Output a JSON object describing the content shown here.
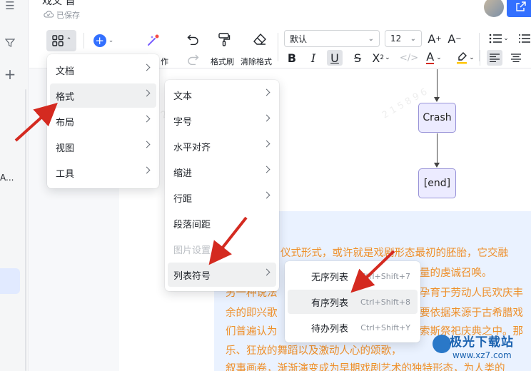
{
  "titlebar": {
    "doc_title": "戏文 首",
    "saved_text": "已保存"
  },
  "left_rail": {
    "partial_text": "A..."
  },
  "toolbar": {
    "font_family": "默认",
    "font_size": "12",
    "ai_label_fragment": "作",
    "format_painter_label": "格式刷",
    "clear_format_label": "清除格式",
    "superscript_mark": "2"
  },
  "main_menu": {
    "items": [
      {
        "label": "文档"
      },
      {
        "label": "格式"
      },
      {
        "label": "布局"
      },
      {
        "label": "视图"
      },
      {
        "label": "工具"
      }
    ]
  },
  "format_menu": {
    "items": [
      {
        "label": "文本"
      },
      {
        "label": "字号"
      },
      {
        "label": "水平对齐"
      },
      {
        "label": "缩进"
      },
      {
        "label": "行距"
      },
      {
        "label": "段落间距"
      },
      {
        "label": "图片设置"
      },
      {
        "label": "列表符号"
      }
    ]
  },
  "list_menu": {
    "items": [
      {
        "label": "无序列表",
        "shortcut": "Ctrl+Shift+7"
      },
      {
        "label": "有序列表",
        "shortcut": "Ctrl+Shift+8"
      },
      {
        "label": "待办列表",
        "shortcut": "Ctrl+Shift+Y"
      }
    ]
  },
  "flowchart": {
    "nodes": [
      "Crash",
      "[end]"
    ]
  },
  "document": {
    "lines": [
      "仪式形式，或许就是戏剧形态最初的胚胎，它交融",
      "量的虔诚召唤。",
      "另一种说法",
      "孕育于劳动人民欢庆丰",
      "余的即兴歌",
      "要依据来源于古希腊戏",
      "们普遍认为",
      "索斯祭祀庆典之中。那",
      "乐、狂放的舞蹈以及激动人心的颂歌，",
      "叙事画卷，渐渐演变成为早期戏剧艺术的独特形态，为人类的"
    ]
  },
  "watermarks": [
    "2 1 5 8 9 6",
    "2 1 5 8 9 6",
    "2 1 5 8 9 6"
  ],
  "logo": {
    "name": "极光下载站",
    "url": "www.xz7.com"
  },
  "colors": {
    "accent": "#3370ff",
    "body_text": "#ee8f2a",
    "annotation_arrow": "#d42a20",
    "flow_node_fill": "#ecebff",
    "flow_node_border": "#9893d8"
  }
}
